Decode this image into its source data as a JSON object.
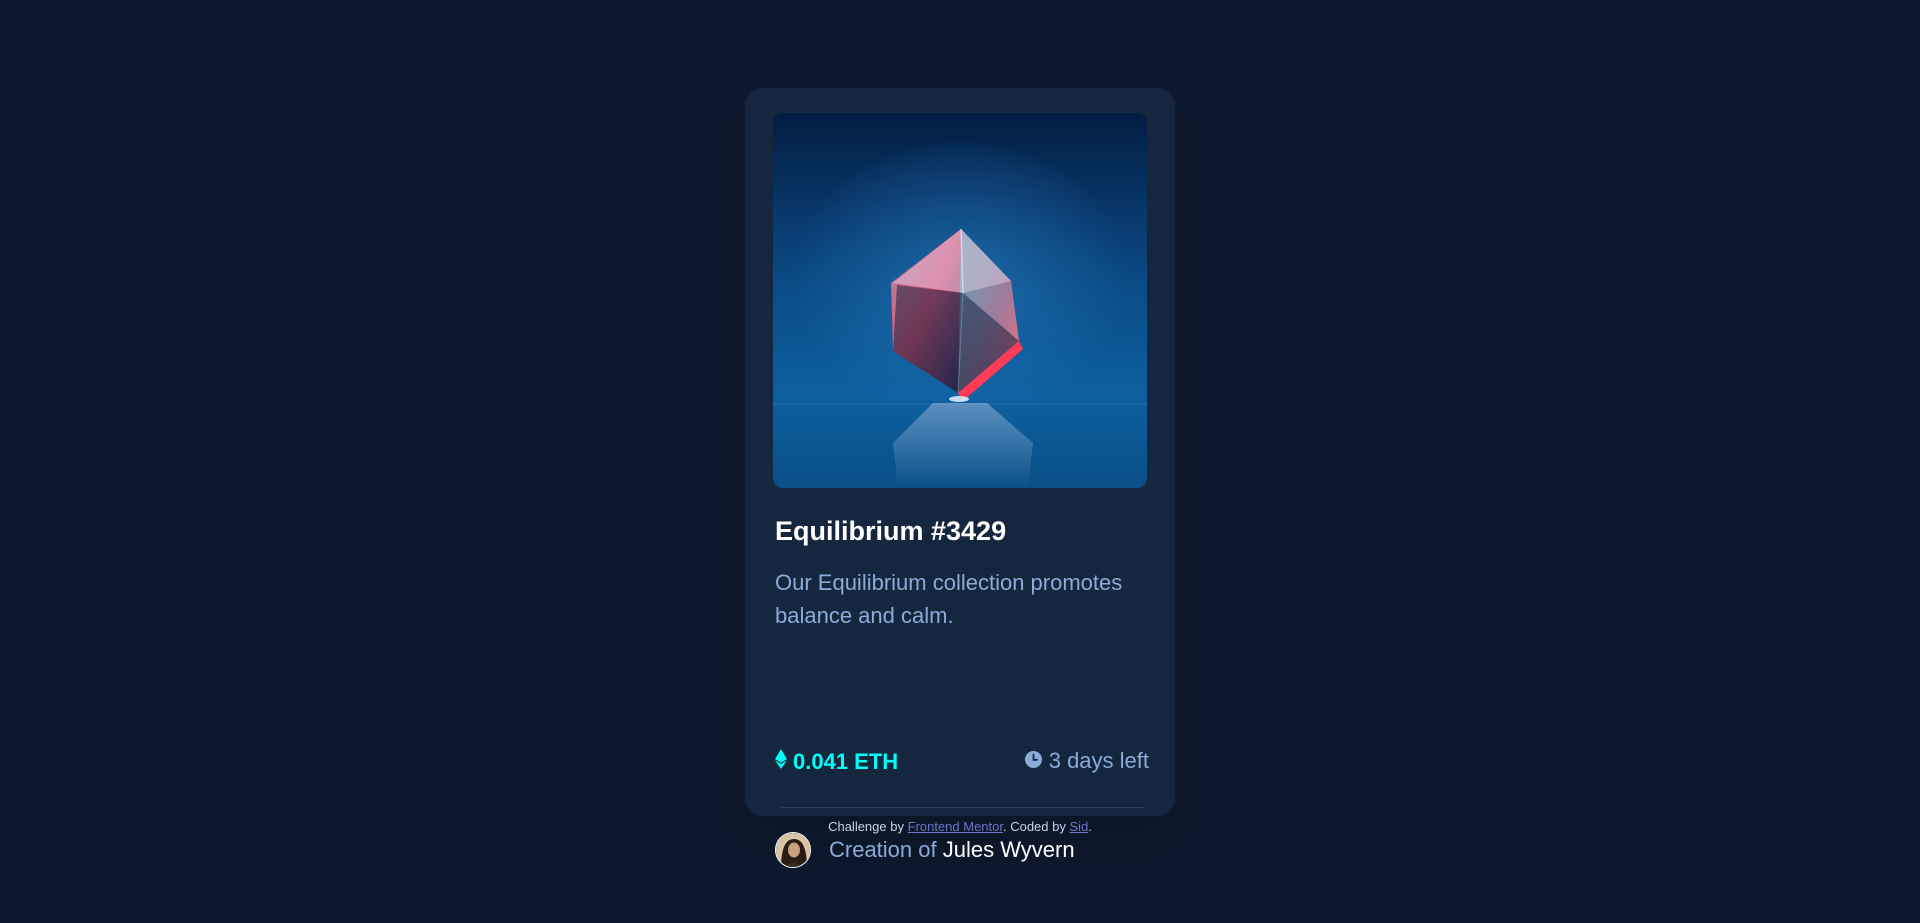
{
  "card": {
    "image_alt": "Equilibrium",
    "title": "Equilibrium #3429",
    "description": "Our Equilibrium collection promotes balance and calm.",
    "price": "0.041 ETH",
    "price_icon": "ethereum-icon",
    "time_left": "3 days left",
    "time_icon": "clock-icon",
    "creator_prefix": "Creation of",
    "creator_name": "Jules Wyvern",
    "avatar_icon": "avatar"
  },
  "footer": {
    "prefix": "Challenge by",
    "link1": "Frontend Mentor",
    "middle": ". Coded by",
    "link2": "Sid",
    "suffix": "."
  },
  "colors": {
    "background": "#0d192c",
    "card": "#15263f",
    "accent_cyan": "#00fff8",
    "soft_blue": "#8bacd9",
    "white": "#ffffff"
  }
}
